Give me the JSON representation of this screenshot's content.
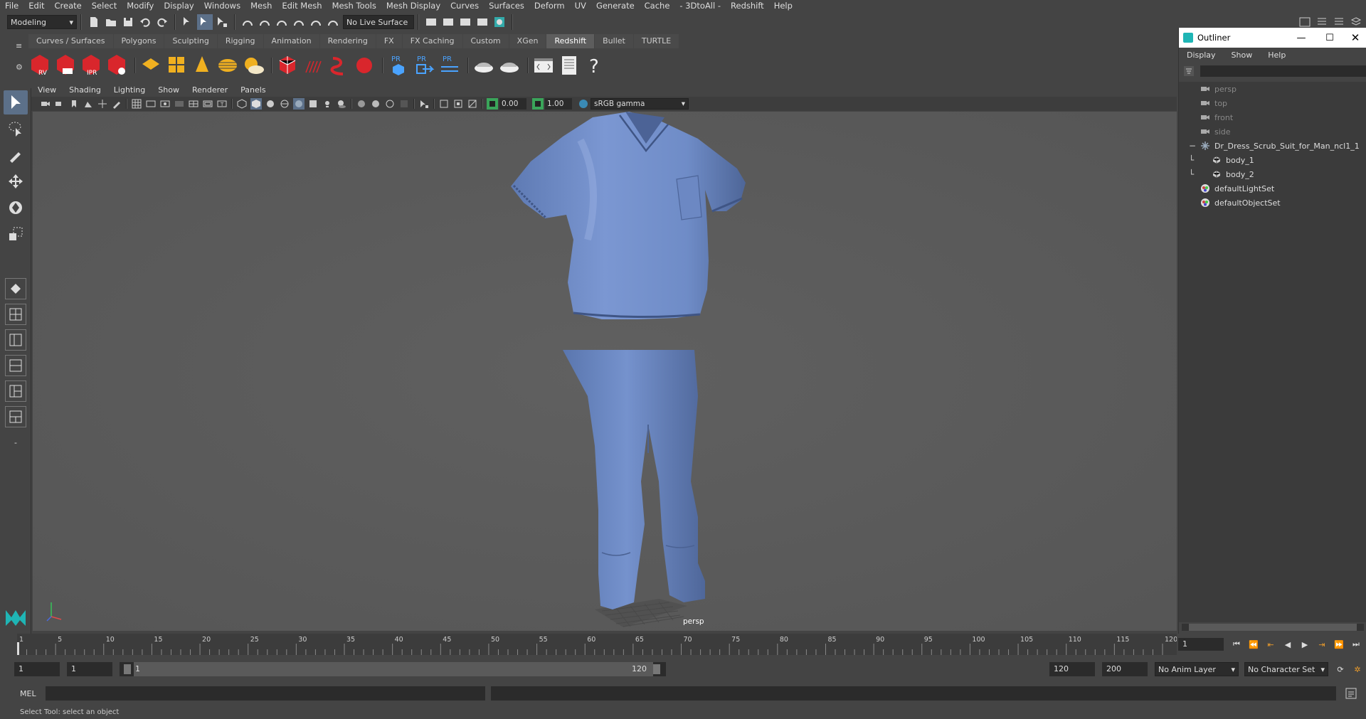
{
  "menubar": {
    "items": [
      "File",
      "Edit",
      "Create",
      "Select",
      "Modify",
      "Display",
      "Windows",
      "Mesh",
      "Edit Mesh",
      "Mesh Tools",
      "Mesh Display",
      "Curves",
      "Surfaces",
      "Deform",
      "UV",
      "Generate",
      "Cache",
      "- 3DtoAll -",
      "Redshift",
      "Help"
    ]
  },
  "statusline": {
    "menuset": "Modeling",
    "live_surface": "No Live Surface"
  },
  "shelf": {
    "tabs": [
      "Curves / Surfaces",
      "Polygons",
      "Sculpting",
      "Rigging",
      "Animation",
      "Rendering",
      "FX",
      "FX Caching",
      "Custom",
      "XGen",
      "Redshift",
      "Bullet",
      "TURTLE"
    ],
    "active_tab": "Redshift",
    "icon_labels": {
      "rv": "RV",
      "ipr": "IPR",
      "pr": "PR"
    }
  },
  "viewport": {
    "menu": [
      "View",
      "Shading",
      "Lighting",
      "Show",
      "Renderer",
      "Panels"
    ],
    "exposure": "0.00",
    "gamma": "1.00",
    "color_space": "sRGB gamma",
    "camera": "persp"
  },
  "outliner": {
    "title": "Outliner",
    "menu": [
      "Display",
      "Show",
      "Help"
    ],
    "items": [
      {
        "label": "persp",
        "indent": 0,
        "dim": true,
        "icon": "camera-icon"
      },
      {
        "label": "top",
        "indent": 0,
        "dim": true,
        "icon": "camera-icon"
      },
      {
        "label": "front",
        "indent": 0,
        "dim": true,
        "icon": "camera-icon"
      },
      {
        "label": "side",
        "indent": 0,
        "dim": true,
        "icon": "camera-icon"
      },
      {
        "label": "Dr_Dress_Scrub_Suit_for_Man_ncl1_1",
        "indent": 0,
        "dim": false,
        "icon": "group-icon",
        "expand": "−"
      },
      {
        "label": "body_1",
        "indent": 1,
        "dim": false,
        "icon": "mesh-icon"
      },
      {
        "label": "body_2",
        "indent": 1,
        "dim": false,
        "icon": "mesh-icon"
      },
      {
        "label": "defaultLightSet",
        "indent": 0,
        "dim": false,
        "icon": "set-icon"
      },
      {
        "label": "defaultObjectSet",
        "indent": 0,
        "dim": false,
        "icon": "set-icon"
      }
    ]
  },
  "timeline": {
    "ticks": [
      "1",
      "5",
      "10",
      "15",
      "20",
      "25",
      "30",
      "35",
      "40",
      "45",
      "50",
      "55",
      "60",
      "65",
      "70",
      "75",
      "80",
      "85",
      "90",
      "95",
      "100",
      "105",
      "110",
      "115",
      "120"
    ],
    "current_frame": "1"
  },
  "range": {
    "start": "1",
    "playback_start": "1",
    "slider_start": "1",
    "slider_end": "120",
    "playback_end": "120",
    "end": "200",
    "anim_layer": "No Anim Layer",
    "character_set": "No Character Set"
  },
  "cmdline": {
    "label": "MEL"
  },
  "helpline": {
    "text": "Select Tool: select an object"
  },
  "colors": {
    "accent": "#5c7089",
    "redshift_red": "#d9262c",
    "mesh_blue": "#6f8cc7"
  }
}
